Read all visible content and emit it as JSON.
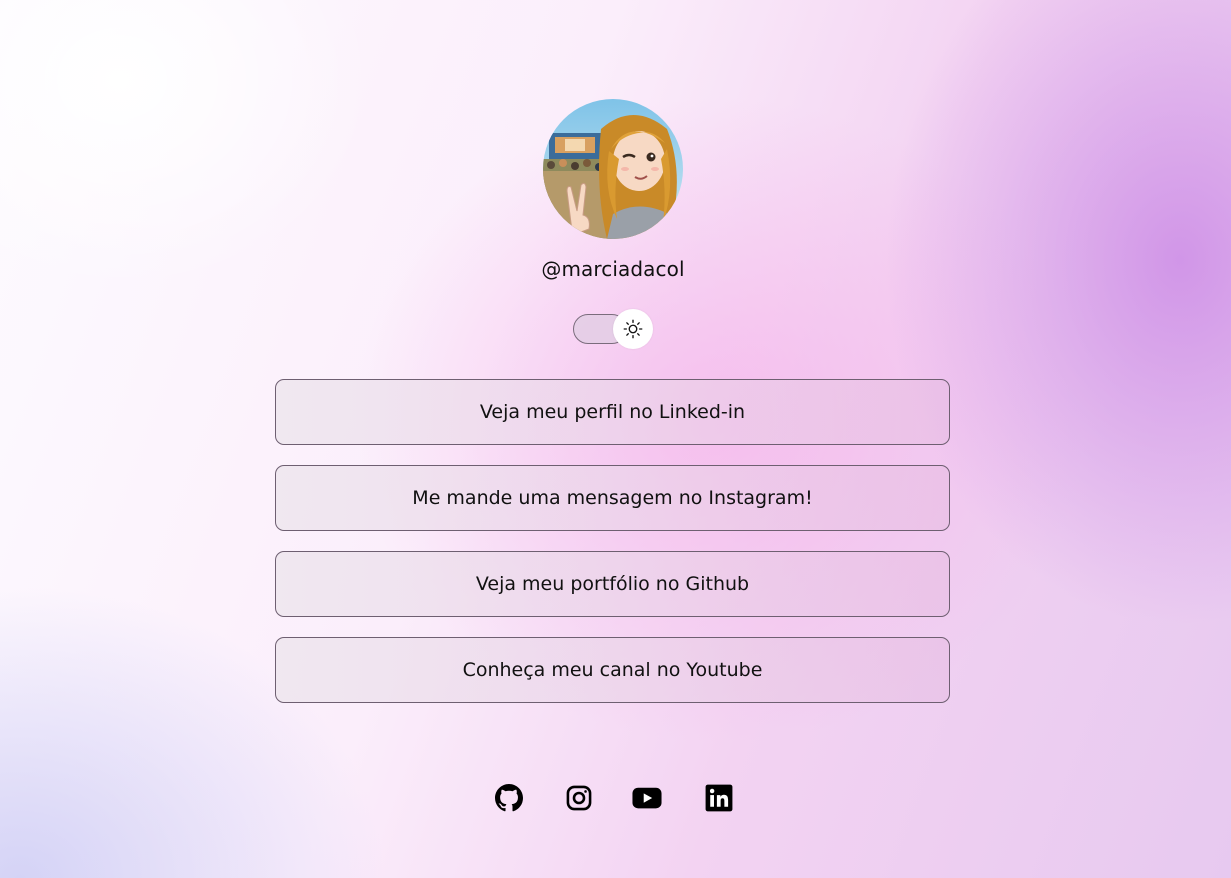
{
  "profile": {
    "username": "@marciadacol",
    "avatar_icon": "profile-avatar-illustration"
  },
  "theme_toggle": {
    "icon": "sun-icon",
    "state": "light"
  },
  "links": [
    {
      "label": "Veja meu perfil no Linked-in"
    },
    {
      "label": "Me mande uma mensagem no Instagram!"
    },
    {
      "label": "Veja meu portfólio no Github"
    },
    {
      "label": "Conheça meu canal no Youtube"
    }
  ],
  "socials": [
    {
      "icon": "github-icon"
    },
    {
      "icon": "instagram-icon"
    },
    {
      "icon": "youtube-icon"
    },
    {
      "icon": "linkedin-icon"
    }
  ],
  "colors": {
    "text": "#111111",
    "button_border": "#6e5f71",
    "accent_purple": "#cc8ce6",
    "accent_pink": "#f5b4eb"
  }
}
